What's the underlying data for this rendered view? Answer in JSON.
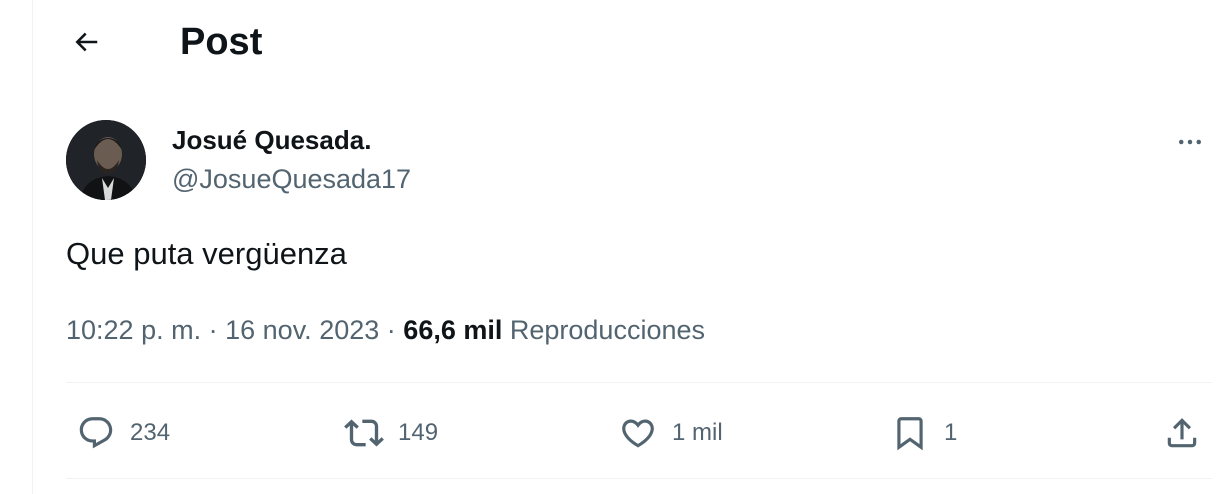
{
  "header": {
    "title": "Post",
    "back_icon": "arrow-left-icon"
  },
  "author": {
    "display_name": "Josué Quesada.",
    "handle": "@JosueQuesada17",
    "avatar_icon": "avatar-photo"
  },
  "post": {
    "text": "Que puta vergüenza",
    "time": "10:22 p. m.",
    "separator": "·",
    "date": "16 nov. 2023",
    "views_count": "66,6 mil",
    "views_label": "Reproducciones"
  },
  "actions": {
    "reply": {
      "icon": "reply-icon",
      "count": "234"
    },
    "repost": {
      "icon": "repost-icon",
      "count": "149"
    },
    "like": {
      "icon": "heart-icon",
      "count": "1 mil"
    },
    "bookmark": {
      "icon": "bookmark-icon",
      "count": "1"
    },
    "share": {
      "icon": "share-icon"
    }
  },
  "colors": {
    "text_primary": "#0f1419",
    "text_secondary": "#536471",
    "divider": "#eff3f4"
  }
}
